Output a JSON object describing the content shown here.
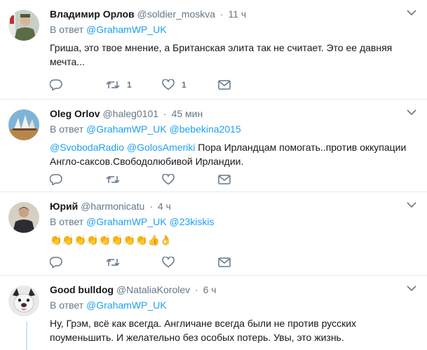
{
  "colors": {
    "link": "#1da1f2",
    "secondary_text": "#657786",
    "primary_text": "#14171a",
    "divider": "#e6ecf0",
    "thread_line": "#cce4f7"
  },
  "reply_prefix": "В ответ",
  "tweets": [
    {
      "name": "Владимир Орлов",
      "handle": "@soldier_moskva",
      "sep": "·",
      "time": "11 ч",
      "reply_mentions": [
        "@GrahamWP_UK"
      ],
      "text": "Гриша, это твое мнение, а Британская элита так не считает. Это ее давняя мечта...",
      "retweet_count": "1",
      "like_count": "1"
    },
    {
      "name": "Oleg Orlov",
      "handle": "@haleg0101",
      "sep": "·",
      "time": "45 мин",
      "reply_mentions": [
        "@GrahamWP_UK",
        "@bebekina2015"
      ],
      "text_mentions": [
        "@SvobodaRadio",
        "@GolosAmeriki"
      ],
      "text": "Пора Ирландцам помогать..против оккупации Англо-саксов.Свободолюбивой Ирландии.",
      "retweet_count": "",
      "like_count": ""
    },
    {
      "name": "Юрий",
      "handle": "@harmonicatu",
      "sep": "·",
      "time": "4 ч",
      "reply_mentions": [
        "@GrahamWP_UK",
        "@23kiskis"
      ],
      "text": "👏👏👏👏👏👏👏👏👍👌",
      "retweet_count": "",
      "like_count": ""
    },
    {
      "name": "Good bulldog",
      "handle": "@NataliaKorolev",
      "sep": "·",
      "time": "6 ч",
      "reply_mentions": [
        "@GrahamWP_UK"
      ],
      "text": "Ну, Грэм, всё как всегда. Англичане всегда были не против русских поуменьшить. И желательно без особых потерь. Увы, это жизнь.",
      "retweet_count": "",
      "like_count": ""
    }
  ],
  "icons": {
    "more": "chevron-down-icon",
    "reply": "reply-icon",
    "retweet": "retweet-icon",
    "like": "heart-icon",
    "dm": "envelope-icon"
  }
}
